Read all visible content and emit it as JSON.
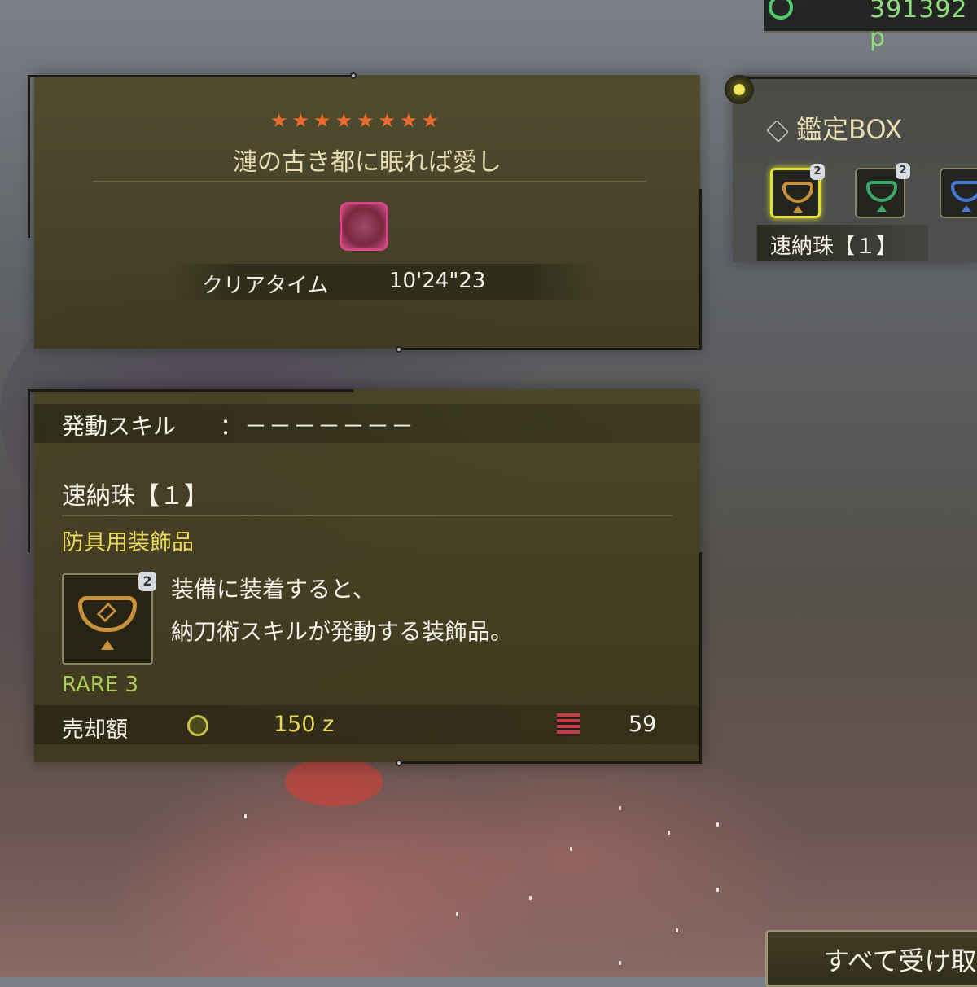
{
  "currency": {
    "value": "391392 p",
    "icon": "research-points-icon"
  },
  "quest": {
    "stars": "★★★★★★★★",
    "star_count": 8,
    "title": "漣の古き都に眠れば愛し",
    "monster_icon": "monster-icon",
    "clear_time_label": "クリアタイム",
    "clear_time_value": "10'24\"23"
  },
  "item": {
    "skill_label": "発動スキル",
    "skill_value": "：－－－－－－－",
    "name": "速納珠【１】",
    "type": "防具用装飾品",
    "icon": "decoration-gem-icon",
    "badge": "2",
    "description_line1": "装備に装着すると、",
    "description_line2": "納刀術スキルが発動する装飾品。",
    "rarity": "RARE 3",
    "sell_label": "売却額",
    "sell_price": "150 z",
    "points_value": "59"
  },
  "appraisal_box": {
    "title": "鑑定BOX",
    "slots": [
      {
        "color": "#c9923a",
        "badge": "2",
        "selected": true
      },
      {
        "color": "#3aa86a",
        "badge": "2",
        "selected": false
      },
      {
        "color": "#4a7ad8",
        "badge": "",
        "selected": false
      }
    ],
    "selected_label": "速納珠【１】"
  },
  "receive_all": {
    "label": "すべて受け取る"
  },
  "colors": {
    "star": "#ee6a2c",
    "item_type": "#e8d85a",
    "rarity": "#a8cc58",
    "currency": "#8fdc7a",
    "selected_slot": "#dfe22a"
  }
}
